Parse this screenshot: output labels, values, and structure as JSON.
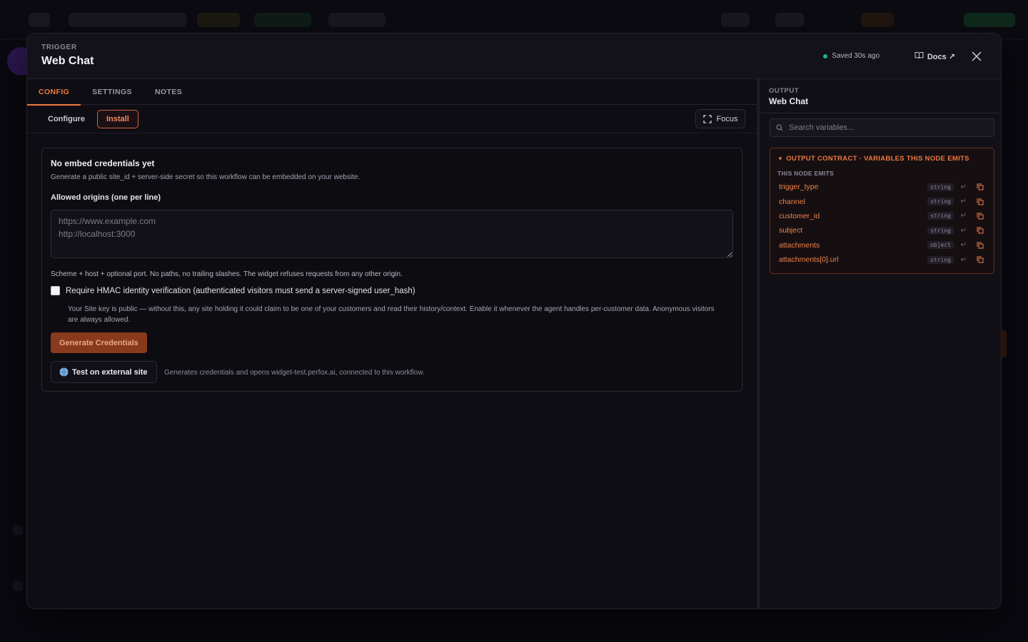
{
  "modal": {
    "eyebrow": "TRIGGER",
    "title": "Web Chat",
    "saved_status": "Saved 30s ago",
    "docs_label": "Docs ↗"
  },
  "tabs": [
    {
      "label": "CONFIG",
      "active": true
    },
    {
      "label": "SETTINGS",
      "active": false
    },
    {
      "label": "NOTES",
      "active": false
    }
  ],
  "subtabs": [
    {
      "label": "Configure",
      "active": false
    },
    {
      "label": "Install",
      "active": true
    }
  ],
  "focus_label": "Focus",
  "embed": {
    "title": "No embed credentials yet",
    "description": "Generate a public site_id + server-side secret so this workflow can be embedded on your website.",
    "origins_label": "Allowed origins (one per line)",
    "origins_placeholder": "https://www.example.com\nhttp://localhost:3000",
    "origins_hint": "Scheme + host + optional port. No paths, no trailing slashes. The widget refuses requests from any other origin.",
    "hmac_label": "Require HMAC identity verification (authenticated visitors must send a server-signed user_hash)",
    "hmac_checked": false,
    "hmac_note": "Your Site key is public — without this, any site holding it could claim to be one of your customers and read their history/context. Enable it whenever the agent handles per-customer data. Anonymous visitors are always allowed.",
    "generate_label": "Generate Credentials",
    "test_label": "Test on external site",
    "test_description": "Generates credentials and opens widget-test.perfox.ai, connected to this workflow."
  },
  "output": {
    "eyebrow": "OUTPUT",
    "title": "Web Chat",
    "search_placeholder": "Search variables...",
    "contract_title": "OUTPUT CONTRACT · VARIABLES THIS NODE EMITS",
    "emits_label": "THIS NODE EMITS",
    "variables": [
      {
        "name": "trigger_type",
        "type": "string"
      },
      {
        "name": "channel",
        "type": "string"
      },
      {
        "name": "customer_id",
        "type": "string"
      },
      {
        "name": "subject",
        "type": "string"
      },
      {
        "name": "attachments",
        "type": "object"
      },
      {
        "name": "attachments[0].url",
        "type": "string"
      }
    ]
  },
  "colors": {
    "accent": "#f07a3e",
    "status_green": "#19b88a",
    "generate_button": "#8a3a1c"
  }
}
